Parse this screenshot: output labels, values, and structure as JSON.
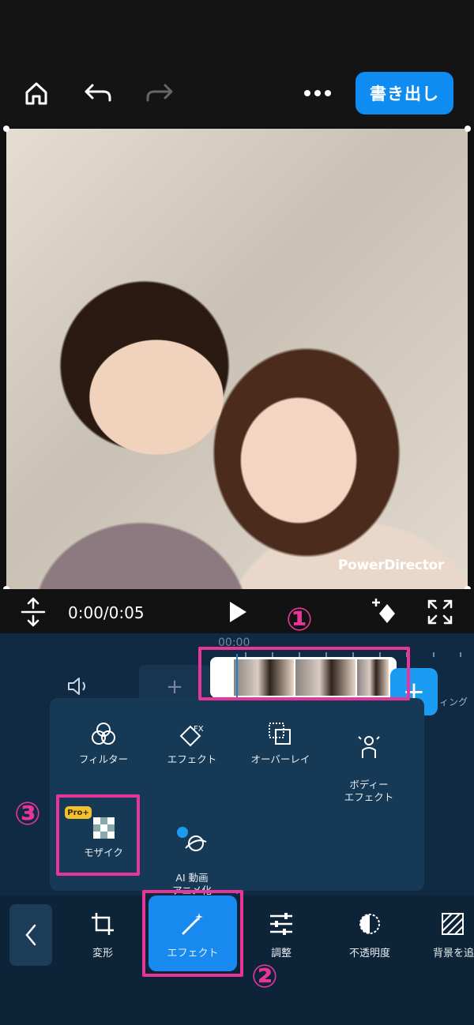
{
  "header": {
    "export_label": "書き出し"
  },
  "preview": {
    "watermark": "PowerDirector"
  },
  "playback": {
    "timecode": "0:00/0:05"
  },
  "timeline": {
    "ruler_time": "00:00",
    "side_label": "ィング"
  },
  "effect_menu": {
    "items": [
      {
        "label": "フィルター",
        "icon": "filter-icon"
      },
      {
        "label": "エフェクト",
        "icon": "fx-icon"
      },
      {
        "label": "オーバーレイ",
        "icon": "overlay-icon"
      },
      {
        "label": "ボディー\nエフェクト",
        "icon": "body-effect-icon"
      },
      {
        "label": "モザイク",
        "icon": "mosaic-icon",
        "badge": "Pro+"
      },
      {
        "label": "AI 動画\nアニメ化",
        "icon": "ai-anime-icon"
      }
    ]
  },
  "toolbar": {
    "items": [
      {
        "label": "変形",
        "icon": "crop-icon"
      },
      {
        "label": "エフェクト",
        "icon": "magic-wand-icon",
        "active": true
      },
      {
        "label": "調整",
        "icon": "sliders-icon"
      },
      {
        "label": "不透明度",
        "icon": "opacity-icon"
      },
      {
        "label": "背景を追",
        "icon": "background-icon"
      }
    ]
  },
  "annotations": {
    "step1": "①",
    "step2": "②",
    "step3": "③"
  },
  "colors": {
    "accent": "#1889ee",
    "annotation": "#e8359a",
    "pro_badge": "#f1c12f"
  }
}
